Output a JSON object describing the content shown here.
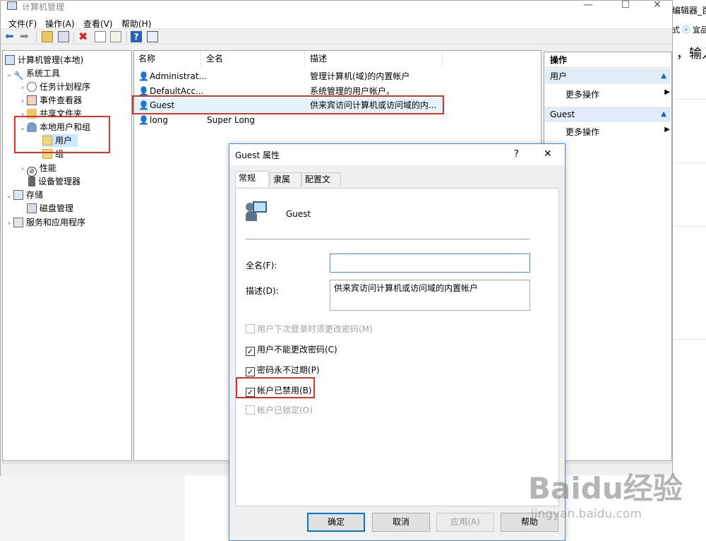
{
  "window": {
    "title": "计算机管理",
    "menu": [
      "文件(F)",
      "操作(A)",
      "查看(V)",
      "帮助(H)"
    ]
  },
  "tree": [
    {
      "label": "计算机管理(本地)",
      "level": 0,
      "expanded": true
    },
    {
      "label": "系统工具",
      "level": 1,
      "expanded": true
    },
    {
      "label": "任务计划程序",
      "level": 2
    },
    {
      "label": "事件查看器",
      "level": 2
    },
    {
      "label": "共享文件夹",
      "level": 2
    },
    {
      "label": "本地用户和组",
      "level": 2,
      "expanded": true
    },
    {
      "label": "用户",
      "level": 3,
      "selected": true
    },
    {
      "label": "组",
      "level": 3
    },
    {
      "label": "性能",
      "level": 2
    },
    {
      "label": "设备管理器",
      "level": 2
    },
    {
      "label": "存储",
      "level": 1,
      "expanded": true
    },
    {
      "label": "磁盘管理",
      "level": 2
    },
    {
      "label": "服务和应用程序",
      "level": 1
    }
  ],
  "list": {
    "columns": [
      "名称",
      "全名",
      "描述"
    ],
    "rows": [
      {
        "name": "Administrat...",
        "fullname": "",
        "desc": "管理计算机(域)的内置帐户"
      },
      {
        "name": "DefaultAcc...",
        "fullname": "",
        "desc": "系统管理的用户帐户。"
      },
      {
        "name": "Guest",
        "fullname": "",
        "desc": "供来宾访问计算机或访问域的内..."
      },
      {
        "name": "long",
        "fullname": "Super Long",
        "desc": ""
      }
    ]
  },
  "actions": {
    "title": "操作",
    "sections": [
      {
        "header": "用户",
        "item": "更多操作"
      },
      {
        "header": "Guest",
        "item": "更多操作"
      }
    ]
  },
  "dialog": {
    "title": "Guest 属性",
    "help": "?",
    "close": "✕",
    "tabs": [
      "常规",
      "隶属于",
      "配置文件"
    ],
    "username": "Guest",
    "fullname_label": "全名(F):",
    "fullname_value": "",
    "desc_label": "描述(D):",
    "desc_value": "供来宾访问计算机或访问域的内置帐户",
    "checkboxes": [
      {
        "label": "用户下次登录时须更改密码(M)",
        "checked": false,
        "disabled": true
      },
      {
        "label": "用户不能更改密码(C)",
        "checked": true,
        "disabled": false
      },
      {
        "label": "密码永不过期(P)",
        "checked": true,
        "disabled": false
      },
      {
        "label": "帐户已禁用(B)",
        "checked": true,
        "disabled": false
      },
      {
        "label": "帐户已锁定(O)",
        "checked": false,
        "disabled": true
      }
    ],
    "buttons": {
      "ok": "确定",
      "cancel": "取消",
      "apply": "应用(A)",
      "help": "帮助"
    }
  },
  "background": {
    "right_text_1": "编辑器_百",
    "right_text_2": "式",
    "right_text_3": "宜品",
    "right_text_4": "，输入"
  },
  "watermark": {
    "brand": "Baidu经验",
    "url": "jingyan.baidu.com"
  },
  "colors": {
    "highlight": "#d9342b",
    "accent": "#0078d7",
    "selected": "#cce8ff"
  }
}
